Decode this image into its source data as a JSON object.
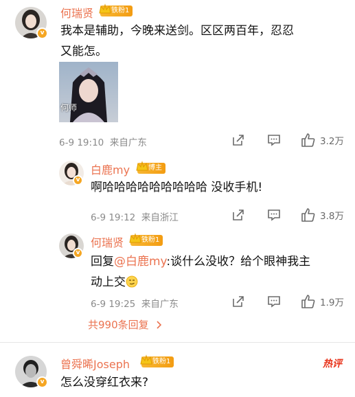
{
  "comments": [
    {
      "name": "何瑞贤",
      "badge": "铁粉1",
      "text_line1": "我本是辅助，今晚来送剑。区区两百年，忍忍",
      "text_line2": "又能怎。",
      "image_caption": "何师",
      "time": "6-9 19:10",
      "location": "来自广东",
      "likes": "3.2万"
    },
    {
      "name": "白鹿my",
      "badge": "博主",
      "text": "啊哈哈哈哈哈哈哈哈哈 没收手机!",
      "time": "6-9 19:12",
      "location": "来自浙江",
      "likes": "3.8万"
    },
    {
      "name": "何瑞贤",
      "badge": "铁粉1",
      "reply_prefix": "回复",
      "mention": "@白鹿my",
      "text_line1_rest": ":谈什么没收？给个眼神我主",
      "text_line2": "动上交",
      "time": "6-9 19:25",
      "location": "来自广东",
      "likes": "1.9万"
    },
    {
      "name": "曾舜晞Joseph",
      "badge": "铁粉1",
      "text": "怎么没穿红衣来?",
      "hot_label": "热评"
    }
  ],
  "more_replies": "共990条回复",
  "colors": {
    "accent": "#eb7350",
    "badge": "#f39c12",
    "hot": "#e8341c"
  },
  "icons": [
    "verified-icon",
    "crown-icon",
    "share-icon",
    "comment-icon",
    "like-icon",
    "chevron-right-icon"
  ]
}
